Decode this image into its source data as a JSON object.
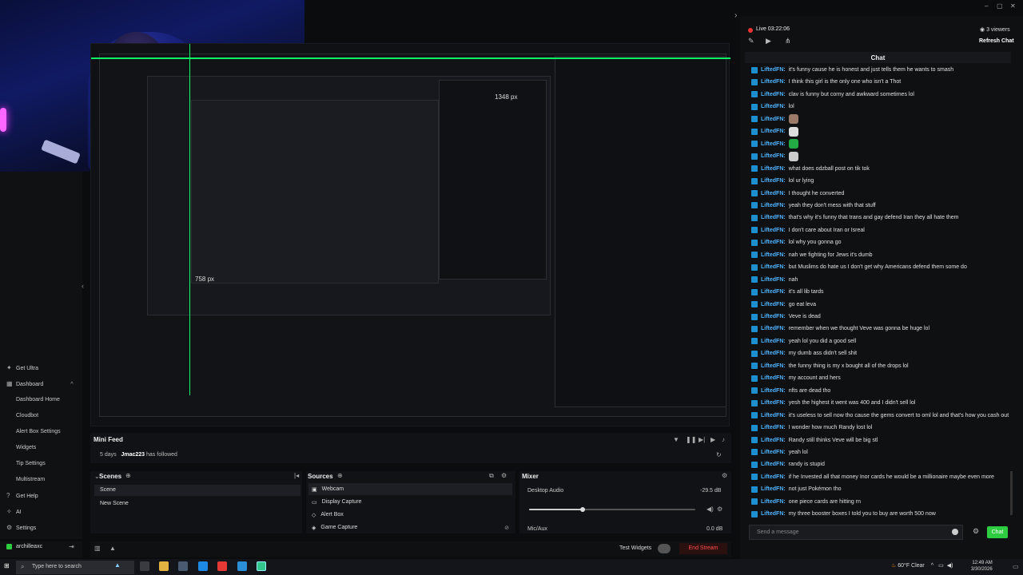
{
  "chat": {
    "live_label": "Live 03:22:06",
    "viewers": "3 viewers",
    "refresh": "Refresh Chat",
    "header": "Chat",
    "input_placeholder": "Send a message",
    "send": "Chat",
    "username": "LiftedFN:",
    "messages": [
      {
        "text": "it's funny cause he is honest and just tells them he wants to smash"
      },
      {
        "text": "I think this girl is the only one who isn't a Thot"
      },
      {
        "text": "clav is funny but corny and awkward sometimes lol"
      },
      {
        "text": "lol"
      },
      {
        "text": "",
        "emote": "#9b7a6a"
      },
      {
        "text": "",
        "emote": "#dddddd"
      },
      {
        "text": "",
        "emote": "#22aa44"
      },
      {
        "text": "",
        "emote": "#cccccc"
      },
      {
        "text": "what does odzball post on tik tok"
      },
      {
        "text": "lol ur lying"
      },
      {
        "text": "I thought he converted"
      },
      {
        "text": "yeah they don't mess with that stuff"
      },
      {
        "text": "that's why it's funny that trans and gay defend Iran they all hate them"
      },
      {
        "text": "I don't care about Iran or Isreal"
      },
      {
        "text": "lol why you gonna go"
      },
      {
        "text": "nah we fighting for Jews it's dumb"
      },
      {
        "text": "but Muslims do hate us I don't get why Americans defend them some do"
      },
      {
        "text": "nah"
      },
      {
        "text": "it's all lib tards"
      },
      {
        "text": "go eat leva"
      },
      {
        "text": "Veve is dead"
      },
      {
        "text": "remember when we thought Veve was gonna be huge lol"
      },
      {
        "text": "yeah lol you did a good sell"
      },
      {
        "text": "my dumb ass didn't sell shit"
      },
      {
        "text": "the funny thing is my x bought all of the drops lol"
      },
      {
        "text": "my account and hers"
      },
      {
        "text": "nfts are dead tho"
      },
      {
        "text": "yesh the highest it went was 400 and I didn't sell lol"
      },
      {
        "text": "it's useless to sell now tho cause the gems convert to oml lol and that's how you cash out"
      },
      {
        "text": "I wonder how much Randy lost lol"
      },
      {
        "text": "Randy still thinks Veve will be big stl"
      },
      {
        "text": "yeah lol"
      },
      {
        "text": "randy is stupid"
      },
      {
        "text": "if he Invested all that money Inor cards he would be a millionaire maybe even more"
      },
      {
        "text": "not just Pokémon tho"
      },
      {
        "text": "one piece cards are hitting rn"
      },
      {
        "text": "my three booster boxes I told you to buy are worth 500 now"
      }
    ]
  },
  "nav": {
    "get_ultra": "Get Ultra",
    "dashboard": "Dashboard",
    "sub": [
      "Dashboard Home",
      "Cloudbot",
      "Alert Box Settings",
      "Widgets",
      "Tip Settings",
      "Multistream"
    ],
    "get_help": "Get Help",
    "ai": "AI",
    "settings": "Settings",
    "user": "archilleaxc"
  },
  "preview": {
    "nested_label_top": "1348 px",
    "nested_label_side": "758 px"
  },
  "minifeed": {
    "title": "Mini Feed",
    "time": "5 days",
    "user": "Jmac223",
    "event": "has followed"
  },
  "scenes": {
    "title": "Scenes",
    "items": [
      "Scene",
      "New Scene"
    ]
  },
  "sources": {
    "title": "Sources",
    "items": [
      "Webcam",
      "Display Capture",
      "Alert Box",
      "Game Capture"
    ]
  },
  "mixer": {
    "title": "Mixer",
    "desktop_label": "Desktop Audio",
    "desktop_db": "-29.5 dB",
    "desktop_level": 0.32,
    "mic_label": "Mic/Aux",
    "mic_db": "0.0 dB"
  },
  "bottom": {
    "test_widgets": "Test Widgets",
    "end_stream": "End Stream"
  },
  "taskbar": {
    "search_placeholder": "Type here to search",
    "weather": "60°F  Clear",
    "time": "12:49 AM",
    "date": "3/30/2026"
  },
  "colors": {
    "accent_green": "#2ecc40",
    "username_blue": "#4fb3ff",
    "live_red": "#ee3333",
    "end_stream_red": "#ff4d4d"
  }
}
